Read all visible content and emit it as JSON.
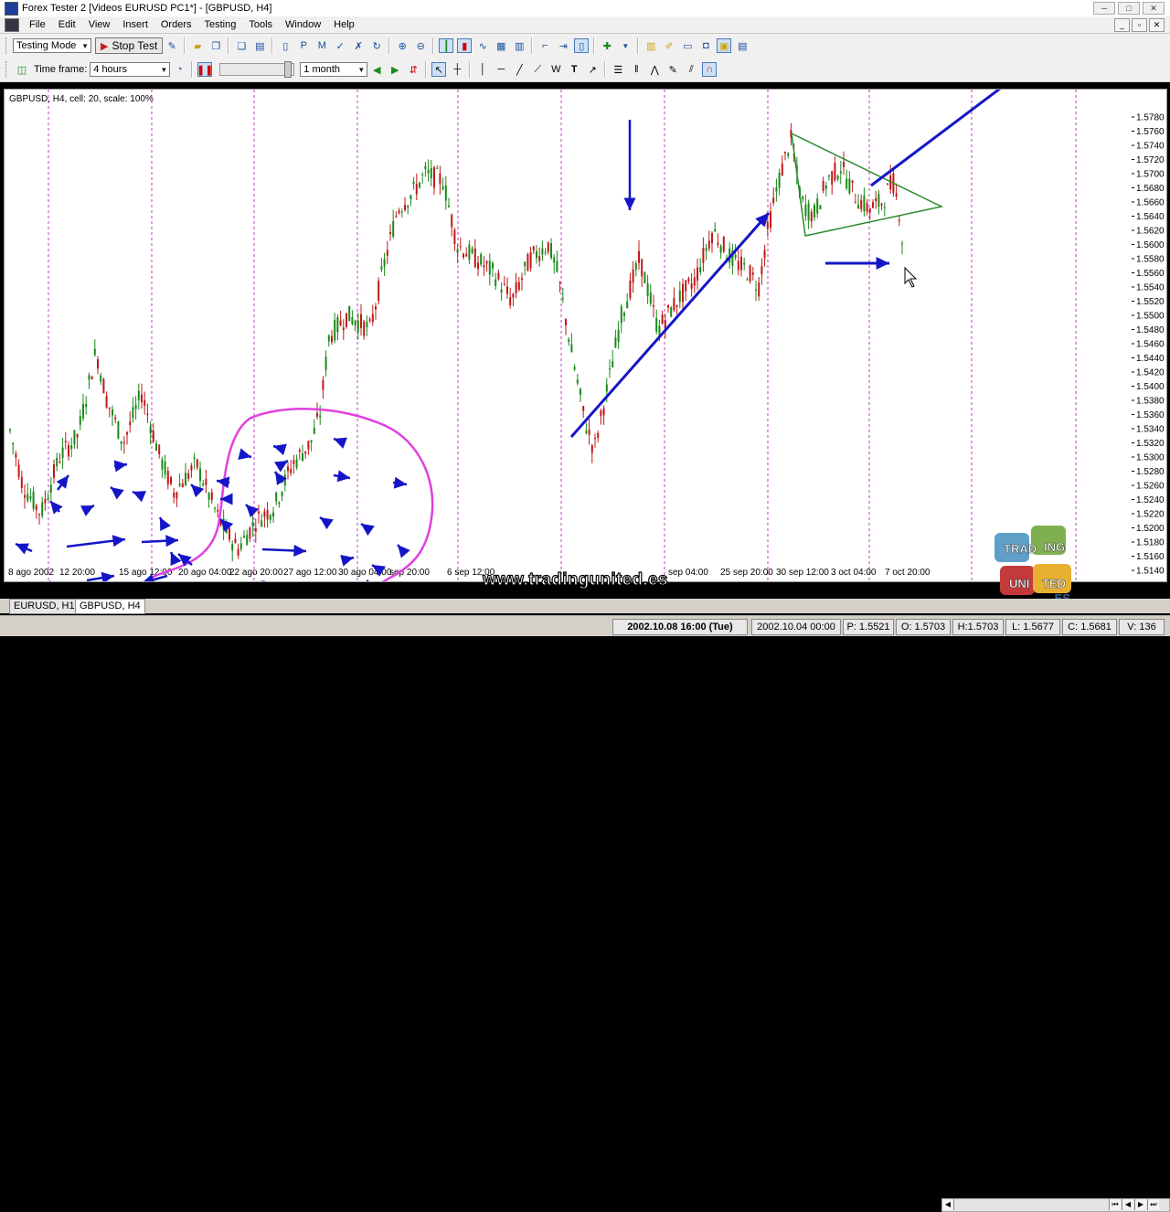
{
  "window": {
    "title": "Forex Tester 2  [Videos EURUSD PC1*] - [GBPUSD, H4]"
  },
  "menu": [
    "File",
    "Edit",
    "View",
    "Insert",
    "Orders",
    "Testing",
    "Tools",
    "Window",
    "Help"
  ],
  "toolbar1": {
    "mode_select": "Testing Mode",
    "stop_button": "Stop Test"
  },
  "toolbar2": {
    "timeframe_label": "Time frame:",
    "timeframe_value": "4 hours",
    "period_value": "1 month"
  },
  "chart": {
    "info_label": "GBPUSD, H4, cell: 20, scale: 100%",
    "price_ticks": [
      "1.5780",
      "1.5760",
      "1.5740",
      "1.5720",
      "1.5700",
      "1.5680",
      "1.5660",
      "1.5640",
      "1.5620",
      "1.5600",
      "1.5580",
      "1.5560",
      "1.5540",
      "1.5520",
      "1.5500",
      "1.5480",
      "1.5460",
      "1.5440",
      "1.5420",
      "1.5400",
      "1.5380",
      "1.5360",
      "1.5340",
      "1.5320",
      "1.5300",
      "1.5280",
      "1.5260",
      "1.5240",
      "1.5220",
      "1.5200",
      "1.5180",
      "1.5160",
      "1.5140"
    ],
    "time_ticks": [
      "8 ago 2002",
      "12 20:00",
      "15 ago 12:00",
      "20 ago 04:00",
      "22 ago 20:00",
      "27 ago 12:00",
      "30 ago 04:00",
      "sep 20:00",
      "6 sep 12:00",
      "sep 04:00",
      "25 sep 20:00",
      "30 sep 12:00",
      "3 oct 04:00",
      "7 oct 20:00"
    ],
    "bull_color": "#1a8a1a",
    "bear_color": "#c01818",
    "period_separator_color": "#c03cc0",
    "annotation_arrow_color": "#1515c8",
    "triangle_color": "#2a8a2a",
    "circle_color": "#e040e0"
  },
  "tabs": [
    "EURUSD, H1",
    "GBPUSD, H4"
  ],
  "status": {
    "datetime": "2002.10.08 16:00 (Tue)",
    "bar_time": "2002.10.04 00:00",
    "price": "P: 1.5521",
    "open": "O: 1.5703",
    "high": "H:1.5703",
    "low": "L: 1.5677",
    "close": "C: 1.5681",
    "volume": "V: 136"
  },
  "watermark": "www.tradingunited.es",
  "logo": {
    "t1": "TRAD",
    "t2": "ING",
    "t3": "UNI",
    "t4": "TED",
    "t5": ".ES"
  }
}
